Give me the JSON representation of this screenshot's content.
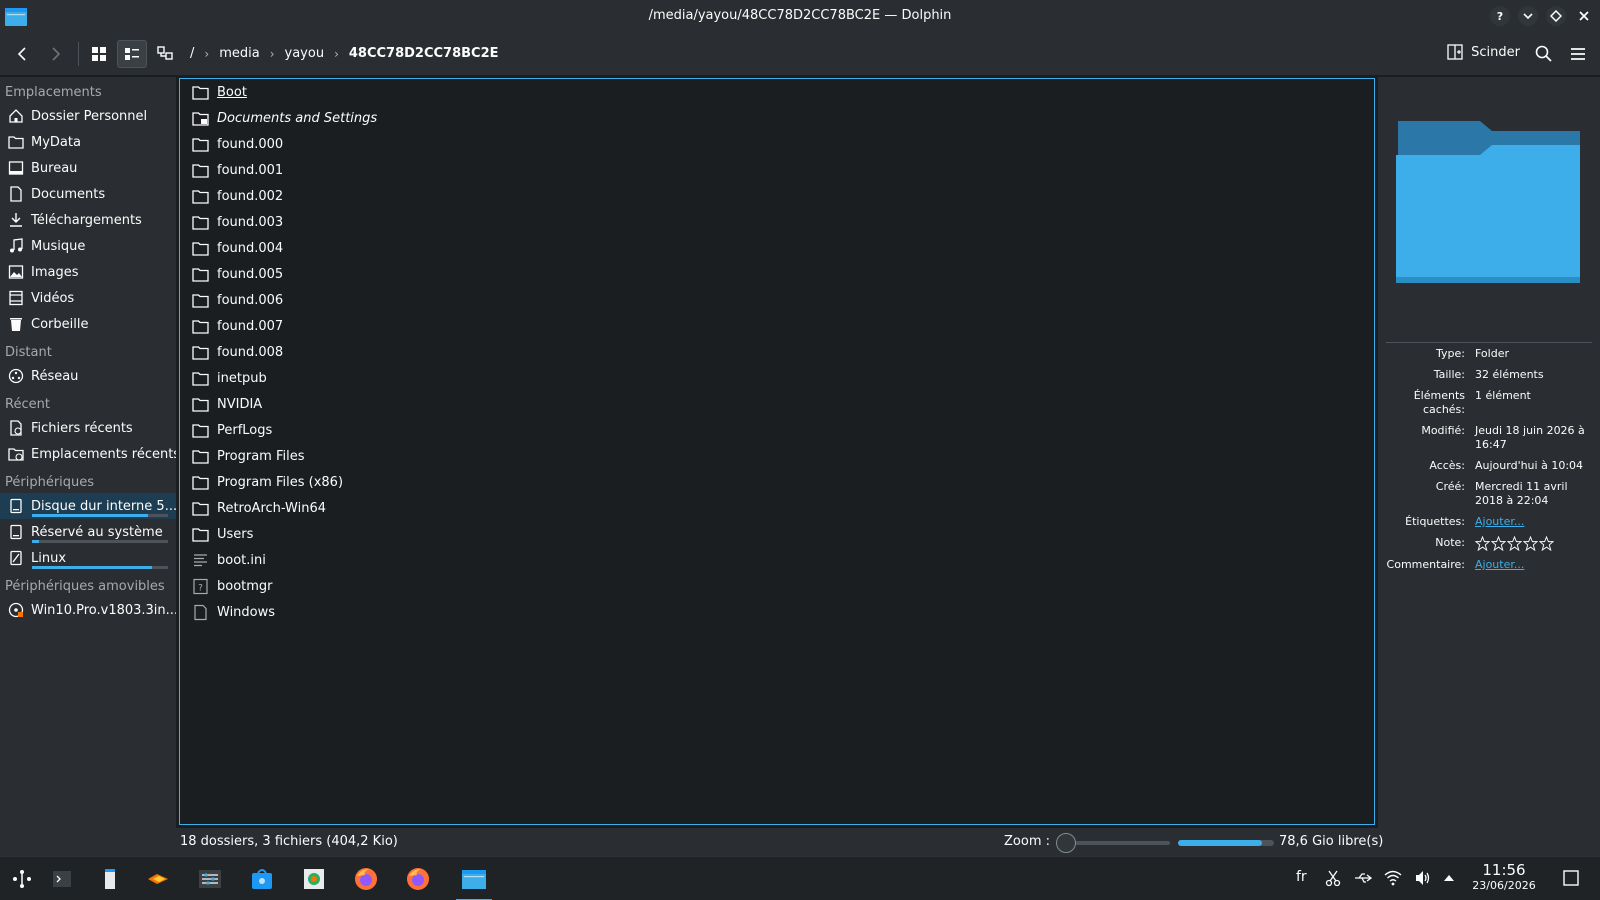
{
  "window": {
    "title": "/media/yayou/48CC78D2CC78BC2E — Dolphin"
  },
  "toolbar": {
    "breadcrumbs": [
      "/",
      "media",
      "yayou",
      "48CC78D2CC78BC2E"
    ],
    "split_label": "Scinder"
  },
  "sidebar": {
    "places_header": "Emplacements",
    "places": [
      {
        "label": "Dossier Personnel",
        "icon": "home-icon"
      },
      {
        "label": "MyData",
        "icon": "folder-icon"
      },
      {
        "label": "Bureau",
        "icon": "desktop-icon"
      },
      {
        "label": "Documents",
        "icon": "document-icon"
      },
      {
        "label": "Téléchargements",
        "icon": "download-icon"
      },
      {
        "label": "Musique",
        "icon": "music-icon"
      },
      {
        "label": "Images",
        "icon": "image-icon"
      },
      {
        "label": "Vidéos",
        "icon": "video-icon"
      },
      {
        "label": "Corbeille",
        "icon": "trash-icon"
      }
    ],
    "remote_header": "Distant",
    "remote": [
      {
        "label": "Réseau",
        "icon": "network-icon"
      }
    ],
    "recent_header": "Récent",
    "recent": [
      {
        "label": "Fichiers récents",
        "icon": "recent-files-icon"
      },
      {
        "label": "Emplacements récents",
        "icon": "recent-places-icon"
      }
    ],
    "devices_header": "Périphériques",
    "devices": [
      {
        "label": "Disque dur interne 5...",
        "icon": "drive-icon",
        "usage": 0.85
      },
      {
        "label": "Réservé au système",
        "icon": "drive-icon",
        "usage": 0.05
      },
      {
        "label": "Linux",
        "icon": "drive-icon",
        "usage": 0.88
      }
    ],
    "removable_header": "Périphériques amovibles",
    "removable": [
      {
        "label": "Win10.Pro.v1803.3in...",
        "icon": "disc-icon"
      }
    ]
  },
  "files": [
    {
      "name": "Boot",
      "type": "folder",
      "style": "under"
    },
    {
      "name": "Documents and Settings",
      "type": "folder-link",
      "style": "italic"
    },
    {
      "name": "found.000",
      "type": "folder",
      "style": ""
    },
    {
      "name": "found.001",
      "type": "folder",
      "style": ""
    },
    {
      "name": "found.002",
      "type": "folder",
      "style": ""
    },
    {
      "name": "found.003",
      "type": "folder",
      "style": ""
    },
    {
      "name": "found.004",
      "type": "folder",
      "style": ""
    },
    {
      "name": "found.005",
      "type": "folder",
      "style": ""
    },
    {
      "name": "found.006",
      "type": "folder",
      "style": ""
    },
    {
      "name": "found.007",
      "type": "folder",
      "style": ""
    },
    {
      "name": "found.008",
      "type": "folder",
      "style": ""
    },
    {
      "name": "inetpub",
      "type": "folder",
      "style": ""
    },
    {
      "name": "NVIDIA",
      "type": "folder",
      "style": ""
    },
    {
      "name": "PerfLogs",
      "type": "folder",
      "style": ""
    },
    {
      "name": "Program Files",
      "type": "folder",
      "style": ""
    },
    {
      "name": "Program Files (x86)",
      "type": "folder",
      "style": ""
    },
    {
      "name": "RetroArch-Win64",
      "type": "folder",
      "style": ""
    },
    {
      "name": "Users",
      "type": "folder",
      "style": ""
    },
    {
      "name": "boot.ini",
      "type": "text",
      "style": ""
    },
    {
      "name": "bootmgr",
      "type": "unknown",
      "style": ""
    },
    {
      "name": "Windows",
      "type": "file",
      "style": ""
    }
  ],
  "info": {
    "rows": [
      {
        "key": "Type:",
        "value": "Folder",
        "link": false
      },
      {
        "key": "Taille:",
        "value": "32 éléments",
        "link": false
      },
      {
        "key": "Éléments cachés:",
        "value": "1 élément",
        "link": false
      },
      {
        "key": "Modifié:",
        "value": "Jeudi 18 juin 2026 à 16:47",
        "link": false
      },
      {
        "key": "Accès:",
        "value": "Aujourd'hui à 10:04",
        "link": false
      },
      {
        "key": "Créé:",
        "value": "Mercredi 11 avril 2018 à 22:04",
        "link": false
      },
      {
        "key": "Étiquettes:",
        "value": "Ajouter...",
        "link": true
      }
    ],
    "rating_label": "Note:",
    "rating": 0,
    "comment_label": "Commentaire:",
    "comment_value": "Ajouter..."
  },
  "status": {
    "summary": "18 dossiers, 3 fichiers (404,2 Kio)",
    "zoom_label": "Zoom :",
    "free_space": "78,6 Gio libre(s)",
    "used_fraction": 0.88
  },
  "taskbar": {
    "language": "fr",
    "time": "11:56",
    "date": "23/06/2026"
  },
  "colors": {
    "accent": "#3daee9",
    "folder": "#3daee9",
    "background": "#1b1e20",
    "panel": "#2a2e32"
  }
}
